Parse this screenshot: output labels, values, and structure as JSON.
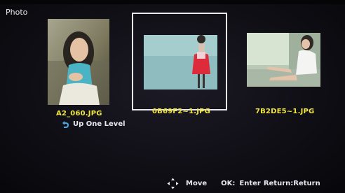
{
  "screen": {
    "title": "Photo"
  },
  "thumbnails": [
    {
      "filename": "A2_060.JPG",
      "selected": false
    },
    {
      "filename": "0B69F2~1.JPG",
      "selected": true
    },
    {
      "filename": "7B2DE5~1.JPG",
      "selected": false
    }
  ],
  "navigation": {
    "up_label": "Up One Level",
    "up_icon": "back-arrow-icon"
  },
  "footer": {
    "move_icon": "dpad-arrows-icon",
    "move_label": "Move",
    "ok_key": "OK:",
    "enter_label": "Enter",
    "return_key": "Return:",
    "return_label": "Return"
  },
  "colors": {
    "caption": "#f0e641",
    "selection": "#e9e9ee",
    "background": "#0b0a10"
  }
}
